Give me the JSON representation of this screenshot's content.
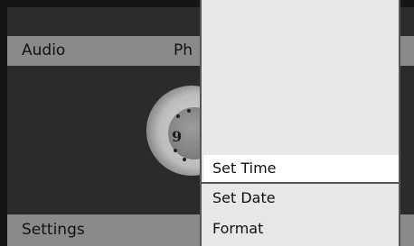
{
  "main_menu": {
    "items": [
      {
        "label": "Audio"
      },
      {
        "label": "Ph"
      }
    ]
  },
  "bottom_bar": {
    "label": "Settings"
  },
  "clock": {
    "numeral": "9"
  },
  "submenu": {
    "items": [
      {
        "label": "Set Time",
        "selected": true
      },
      {
        "label": "Set Date",
        "selected": false
      },
      {
        "label": "Format",
        "selected": false
      }
    ]
  }
}
